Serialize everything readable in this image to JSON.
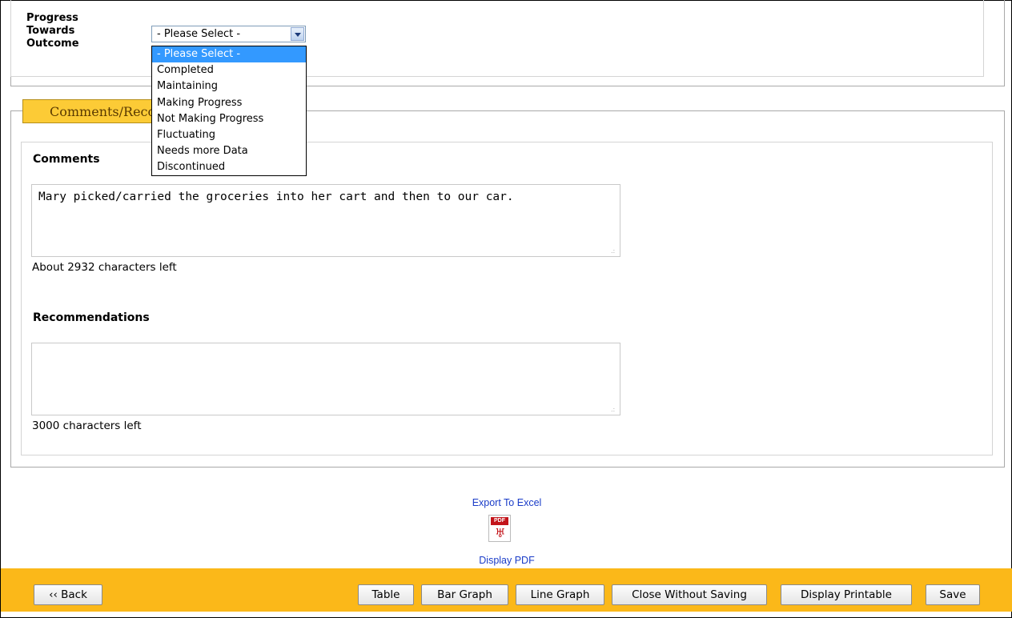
{
  "outcome": {
    "label_lines": [
      "Progress",
      "Towards",
      "Outcome"
    ],
    "selected": "- Please Select -",
    "options": [
      "- Please Select -",
      "Completed",
      "Maintaining",
      "Making Progress",
      "Not Making Progress",
      "Fluctuating",
      "Needs more Data",
      "Discontinued"
    ]
  },
  "section": {
    "tab_label": "Comments/Recommendations"
  },
  "comments": {
    "label": "Comments",
    "value": "Mary picked/carried the groceries into her cart and then to our car.",
    "counter": "About 2932 characters left"
  },
  "recommendations": {
    "label": "Recommendations",
    "value": "",
    "counter": "3000 characters left"
  },
  "exports": {
    "excel": "Export To Excel",
    "pdf": "Display PDF",
    "pdf_icon_text": "PDF"
  },
  "toolbar": {
    "back": "‹‹ Back",
    "table": "Table",
    "bar_graph": "Bar Graph",
    "line_graph": "Line Graph",
    "close_without_saving": "Close Without Saving",
    "display_printable": "Display Printable",
    "save": "Save"
  },
  "colors": {
    "accent": "#fbb819",
    "selection": "#3399ff",
    "link": "#1a3cc8"
  }
}
